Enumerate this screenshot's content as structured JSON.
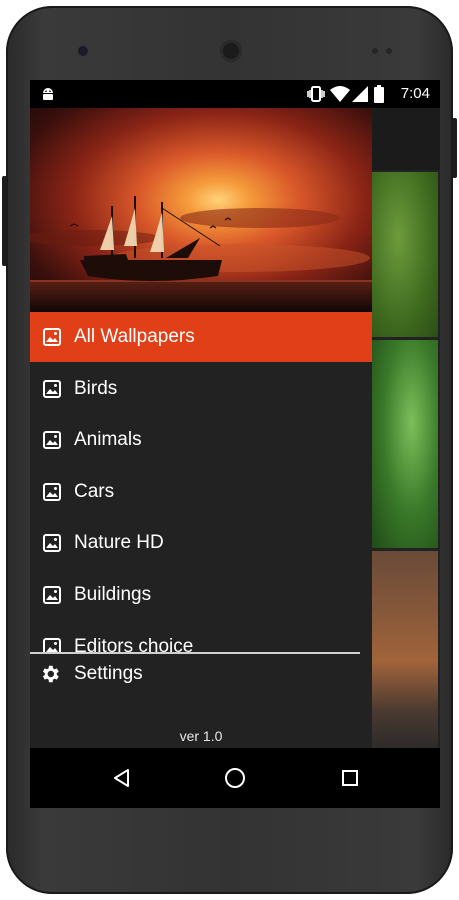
{
  "status_bar": {
    "time": "7:04",
    "icons": [
      "android-icon",
      "vibrate-icon",
      "wifi-icon",
      "cell-signal-icon",
      "battery-icon"
    ]
  },
  "drawer": {
    "menu_items": [
      {
        "label": "All Wallpapers",
        "active": true,
        "icon": "image-icon"
      },
      {
        "label": "Birds",
        "active": false,
        "icon": "image-icon"
      },
      {
        "label": "Animals",
        "active": false,
        "icon": "image-icon"
      },
      {
        "label": "Cars",
        "active": false,
        "icon": "image-icon"
      },
      {
        "label": "Nature HD",
        "active": false,
        "icon": "image-icon"
      },
      {
        "label": "Buildings",
        "active": false,
        "icon": "image-icon"
      },
      {
        "label": "Editors choice",
        "active": false,
        "icon": "image-icon"
      }
    ],
    "settings_label": "Settings",
    "version": "ver 1.0"
  },
  "colors": {
    "accent": "#e13f18",
    "drawer_bg": "#222222",
    "text": "#ffffff"
  },
  "nav_bar": {
    "buttons": [
      "back-icon",
      "home-icon",
      "recents-icon"
    ]
  }
}
